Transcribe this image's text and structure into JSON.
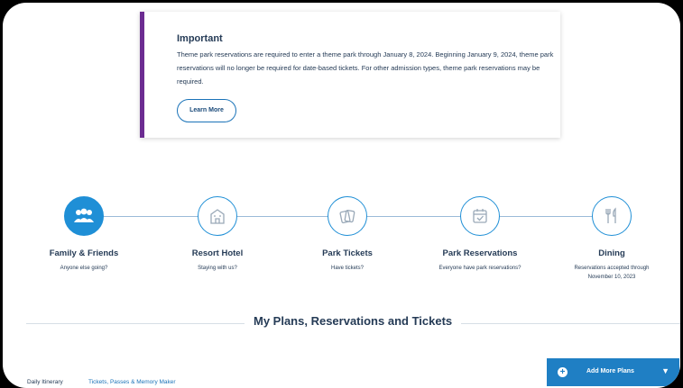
{
  "notice": {
    "title": "Important",
    "body": "Theme park reservations are required to enter a theme park through January 8, 2024. Beginning January 9, 2024, theme park reservations will no longer be required for date-based tickets. For other admission types, theme park reservations may be required.",
    "button_label": "Learn More"
  },
  "steps": [
    {
      "title": "Family & Friends",
      "subtitle": "Anyone else going?",
      "icon": "family-icon"
    },
    {
      "title": "Resort Hotel",
      "subtitle": "Staying with us?",
      "icon": "hotel-icon"
    },
    {
      "title": "Park Tickets",
      "subtitle": "Have tickets?",
      "icon": "tickets-icon"
    },
    {
      "title": "Park Reservations",
      "subtitle": "Everyone have park reservations?",
      "icon": "calendar-check-icon"
    },
    {
      "title": "Dining",
      "subtitle": "Reservations accepted through November 10, 2023",
      "icon": "dining-icon"
    }
  ],
  "plans": {
    "title": "My Plans, Reservations and Tickets",
    "tabs": [
      "Daily Itinerary",
      "Tickets, Passes & Memory Maker"
    ],
    "add_button_label": "Add More Plans"
  },
  "colors": {
    "accent_purple": "#6c2c91",
    "primary_blue": "#1f8fd6",
    "button_blue": "#1f7fc4",
    "text_navy": "#253b56"
  }
}
